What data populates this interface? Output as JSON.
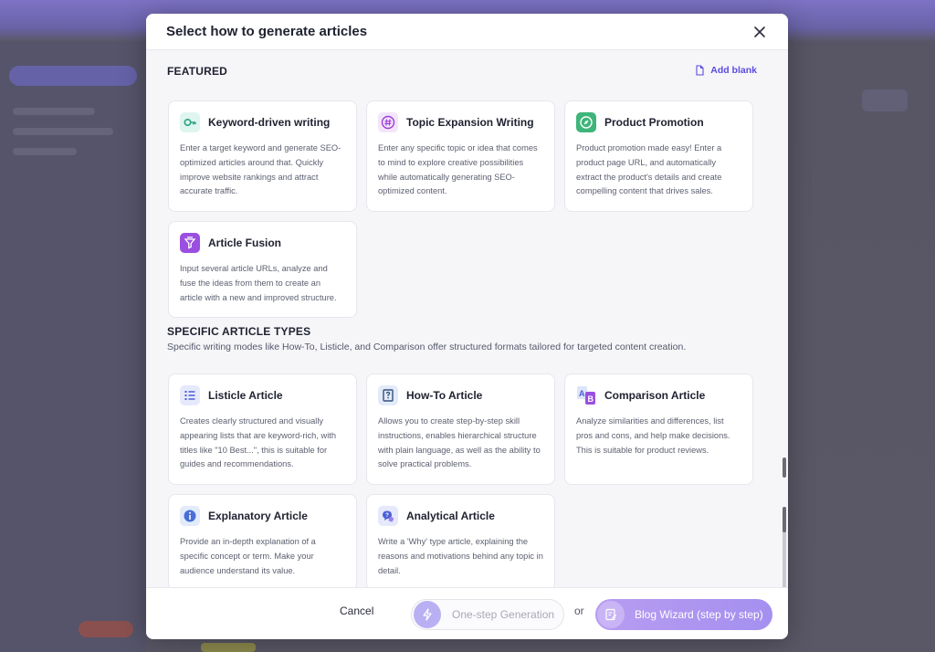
{
  "modal": {
    "title": "Select how to generate articles",
    "add_blank": "Add blank"
  },
  "featured": {
    "heading": "FEATURED",
    "cards": [
      {
        "title": "Keyword-driven writing",
        "desc": "Enter a target keyword and generate SEO-optimized articles around that. Quickly improve website rankings and attract accurate traffic.",
        "icon": "key-icon"
      },
      {
        "title": "Topic Expansion Writing",
        "desc": "Enter any specific topic or idea that comes to mind to explore creative possibilities while automatically generating SEO-optimized content.",
        "icon": "hashtag-icon"
      },
      {
        "title": "Product Promotion",
        "desc": "Product promotion made easy! Enter a product page URL, and automatically extract the product's details and create compelling content that drives sales.",
        "icon": "compass-icon"
      },
      {
        "title": "Article Fusion",
        "desc": "Input several article URLs, analyze and fuse the ideas from them to create an article with a new and improved structure.",
        "icon": "funnel-icon"
      }
    ]
  },
  "specific": {
    "heading": "SPECIFIC ARTICLE TYPES",
    "description": "Specific writing modes like How-To, Listicle, and Comparison offer structured formats tailored for targeted content creation.",
    "cards": [
      {
        "title": "Listicle Article",
        "desc": "Creates clearly structured and visually appearing lists that are keyword-rich, with titles like \"10 Best...\", this is suitable for guides and recommendations.",
        "icon": "list-icon"
      },
      {
        "title": "How-To Article",
        "desc": "Allows you to create step-by-step skill instructions, enables hierarchical structure with plain language, as well as the ability to solve practical problems.",
        "icon": "question-book-icon"
      },
      {
        "title": "Comparison Article",
        "desc": "Analyze similarities and differences, list pros and cons, and help make decisions. This is suitable for product reviews.",
        "icon": "ab-compare-icon"
      },
      {
        "title": "Explanatory Article",
        "desc": "Provide an in-depth explanation of a specific concept or term. Make your audience understand its value.",
        "icon": "info-icon"
      },
      {
        "title": "Analytical Article",
        "desc": "Write a 'Why' type article, explaining the reasons and motivations behind any topic in detail.",
        "icon": "chat-question-icon"
      }
    ]
  },
  "footer": {
    "cancel": "Cancel",
    "one_step": "One-step Generation",
    "or": "or",
    "wizard": "Blog Wizard (step by step)"
  },
  "colors": {
    "accent": "#5b4be0",
    "wizard": "#a896f0"
  }
}
